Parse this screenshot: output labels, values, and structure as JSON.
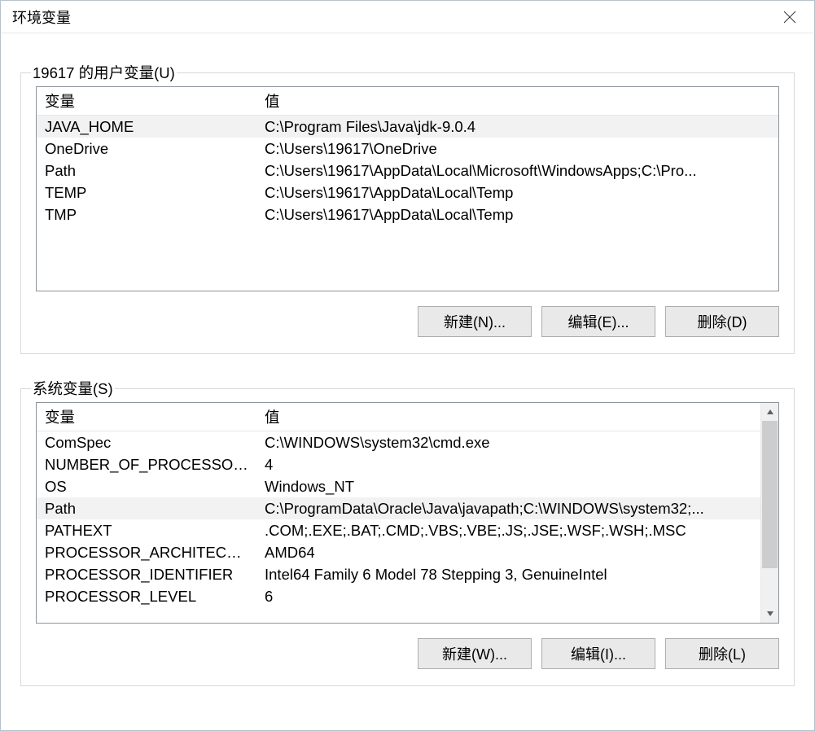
{
  "window": {
    "title": "环境变量",
    "close_icon": "close-icon"
  },
  "user_vars": {
    "group_label": "19617 的用户变量(U)",
    "columns": {
      "name": "变量",
      "value": "值"
    },
    "rows": [
      {
        "name": "JAVA_HOME",
        "value": "C:\\Program Files\\Java\\jdk-9.0.4",
        "selected": true
      },
      {
        "name": "OneDrive",
        "value": "C:\\Users\\19617\\OneDrive",
        "selected": false
      },
      {
        "name": "Path",
        "value": "C:\\Users\\19617\\AppData\\Local\\Microsoft\\WindowsApps;C:\\Pro...",
        "selected": false
      },
      {
        "name": "TEMP",
        "value": "C:\\Users\\19617\\AppData\\Local\\Temp",
        "selected": false
      },
      {
        "name": "TMP",
        "value": "C:\\Users\\19617\\AppData\\Local\\Temp",
        "selected": false
      }
    ],
    "buttons": {
      "new": "新建(N)...",
      "edit": "编辑(E)...",
      "delete": "删除(D)"
    }
  },
  "system_vars": {
    "group_label": "系统变量(S)",
    "columns": {
      "name": "变量",
      "value": "值"
    },
    "rows": [
      {
        "name": "ComSpec",
        "value": "C:\\WINDOWS\\system32\\cmd.exe",
        "selected": false
      },
      {
        "name": "NUMBER_OF_PROCESSORS",
        "value": "4",
        "selected": false
      },
      {
        "name": "OS",
        "value": "Windows_NT",
        "selected": false
      },
      {
        "name": "Path",
        "value": "C:\\ProgramData\\Oracle\\Java\\javapath;C:\\WINDOWS\\system32;...",
        "selected": true
      },
      {
        "name": "PATHEXT",
        "value": ".COM;.EXE;.BAT;.CMD;.VBS;.VBE;.JS;.JSE;.WSF;.WSH;.MSC",
        "selected": false
      },
      {
        "name": "PROCESSOR_ARCHITECTU...",
        "value": "AMD64",
        "selected": false
      },
      {
        "name": "PROCESSOR_IDENTIFIER",
        "value": "Intel64 Family 6 Model 78 Stepping 3, GenuineIntel",
        "selected": false
      },
      {
        "name": "PROCESSOR_LEVEL",
        "value": "6",
        "selected": false
      }
    ],
    "buttons": {
      "new": "新建(W)...",
      "edit": "编辑(I)...",
      "delete": "删除(L)"
    }
  }
}
